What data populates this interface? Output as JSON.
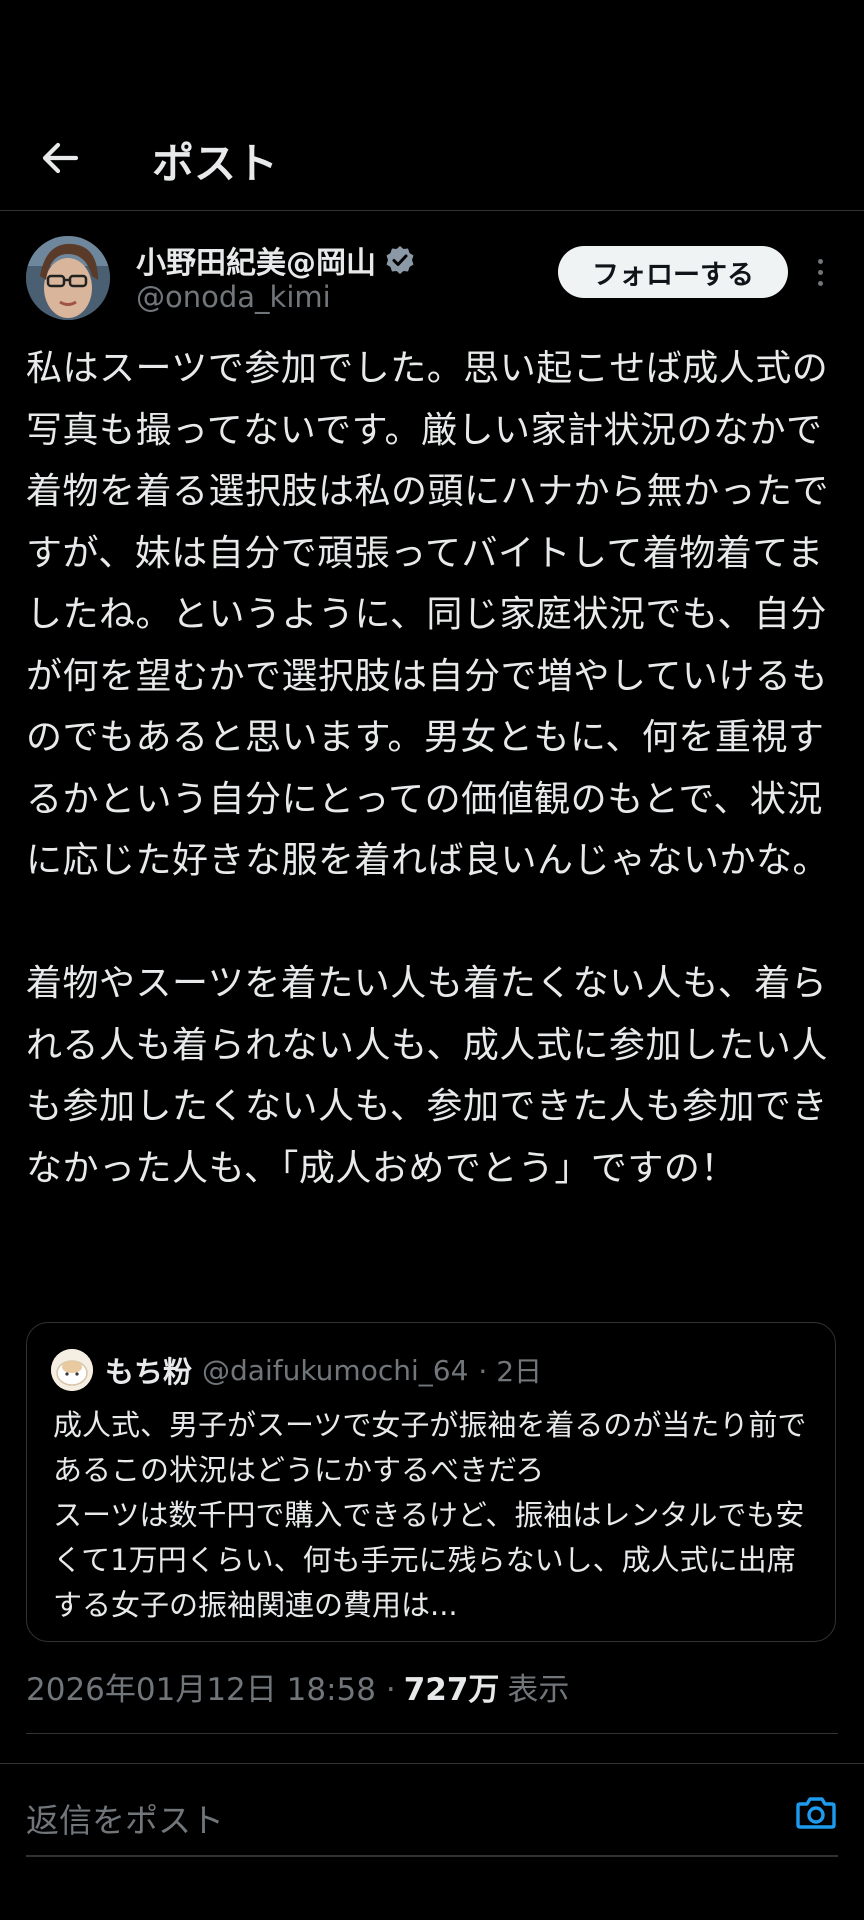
{
  "header": {
    "title": "ポスト",
    "back_icon": "arrow-left-icon"
  },
  "author": {
    "name": "小野田紀美@岡山",
    "handle": "@onoda_kimi",
    "verified_icon": "verified-badge-icon",
    "verified_color": "#8b98a5",
    "follow_label": "フォローする"
  },
  "post": {
    "text": "私はスーツで参加でした。思い起こせば成人式の写真も撮ってないです。厳しい家計状況のなかで着物を着る選択肢は私の頭にハナから無かったですが、妹は自分で頑張ってバイトして着物着てましたね。というように、同じ家庭状況でも、自分が何を望むかで選択肢は自分で増やしていけるものでもあると思います。男女ともに、何を重視するかという自分にとっての価値観のもとで、状況に応じた好きな服を着れば良いんじゃないかな。\n\n着物やスーツを着たい人も着たくない人も、着られる人も着られない人も、成人式に参加したい人も参加したくない人も、参加できた人も参加できなかった人も、「成人おめでとう」ですの！"
  },
  "quote": {
    "name": "もち粉",
    "handle": "@daifukumochi_64",
    "time": "· 2日",
    "text": "成人式、男子がスーツで女子が振袖を着るのが当たり前であるこの状況はどうにかするべきだろ\nスーツは数千円で購入できるけど、振袖はレンタルでも安くて1万円くらい、何も手元に残らないし、成人式に出席する女子の振袖関連の費用は..."
  },
  "meta": {
    "datetime": "2026年01月12日 18:58 ·",
    "views": "727万",
    "views_label": "表示"
  },
  "reply": {
    "placeholder": "返信をポスト",
    "camera_icon": "camera-icon",
    "accent": "#1d9bf0"
  }
}
